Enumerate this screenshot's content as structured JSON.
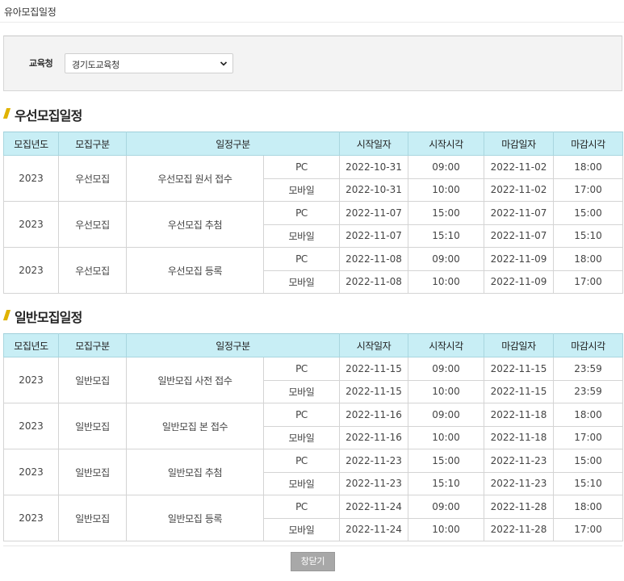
{
  "page": {
    "title": "유아모집일정"
  },
  "filter": {
    "label": "교육청",
    "selected": "경기도교육청"
  },
  "columns": [
    "모집년도",
    "모집구분",
    "일정구분",
    "시작일자",
    "시작시각",
    "마감일자",
    "마감시각"
  ],
  "sections": [
    {
      "title": "우선모집일정",
      "groups": [
        {
          "year": "2023",
          "type": "우선모집",
          "schedule": "우선모집 원서 접수",
          "rows": [
            {
              "device": "PC",
              "start_date": "2022-10-31",
              "start_time": "09:00",
              "end_date": "2022-11-02",
              "end_time": "18:00"
            },
            {
              "device": "모바일",
              "start_date": "2022-10-31",
              "start_time": "10:00",
              "end_date": "2022-11-02",
              "end_time": "17:00"
            }
          ]
        },
        {
          "year": "2023",
          "type": "우선모집",
          "schedule": "우선모집 추첨",
          "rows": [
            {
              "device": "PC",
              "start_date": "2022-11-07",
              "start_time": "15:00",
              "end_date": "2022-11-07",
              "end_time": "15:00"
            },
            {
              "device": "모바일",
              "start_date": "2022-11-07",
              "start_time": "15:10",
              "end_date": "2022-11-07",
              "end_time": "15:10"
            }
          ]
        },
        {
          "year": "2023",
          "type": "우선모집",
          "schedule": "우선모집 등록",
          "rows": [
            {
              "device": "PC",
              "start_date": "2022-11-08",
              "start_time": "09:00",
              "end_date": "2022-11-09",
              "end_time": "18:00"
            },
            {
              "device": "모바일",
              "start_date": "2022-11-08",
              "start_time": "10:00",
              "end_date": "2022-11-09",
              "end_time": "17:00"
            }
          ]
        }
      ]
    },
    {
      "title": "일반모집일정",
      "groups": [
        {
          "year": "2023",
          "type": "일반모집",
          "schedule": "일반모집 사전 접수",
          "rows": [
            {
              "device": "PC",
              "start_date": "2022-11-15",
              "start_time": "09:00",
              "end_date": "2022-11-15",
              "end_time": "23:59"
            },
            {
              "device": "모바일",
              "start_date": "2022-11-15",
              "start_time": "10:00",
              "end_date": "2022-11-15",
              "end_time": "23:59"
            }
          ]
        },
        {
          "year": "2023",
          "type": "일반모집",
          "schedule": "일반모집 본 접수",
          "rows": [
            {
              "device": "PC",
              "start_date": "2022-11-16",
              "start_time": "09:00",
              "end_date": "2022-11-18",
              "end_time": "18:00"
            },
            {
              "device": "모바일",
              "start_date": "2022-11-16",
              "start_time": "10:00",
              "end_date": "2022-11-18",
              "end_time": "17:00"
            }
          ]
        },
        {
          "year": "2023",
          "type": "일반모집",
          "schedule": "일반모집 추첨",
          "rows": [
            {
              "device": "PC",
              "start_date": "2022-11-23",
              "start_time": "15:00",
              "end_date": "2022-11-23",
              "end_time": "15:00"
            },
            {
              "device": "모바일",
              "start_date": "2022-11-23",
              "start_time": "15:10",
              "end_date": "2022-11-23",
              "end_time": "15:10"
            }
          ]
        },
        {
          "year": "2023",
          "type": "일반모집",
          "schedule": "일반모집 등록",
          "rows": [
            {
              "device": "PC",
              "start_date": "2022-11-24",
              "start_time": "09:00",
              "end_date": "2022-11-28",
              "end_time": "18:00"
            },
            {
              "device": "모바일",
              "start_date": "2022-11-24",
              "start_time": "10:00",
              "end_date": "2022-11-28",
              "end_time": "17:00"
            }
          ]
        }
      ]
    }
  ],
  "footer": {
    "close_label": "창닫기"
  },
  "colors": {
    "header_bg": "#c8eef5",
    "section_marker": "#e0b300",
    "button_bg": "#a8a8a8"
  }
}
